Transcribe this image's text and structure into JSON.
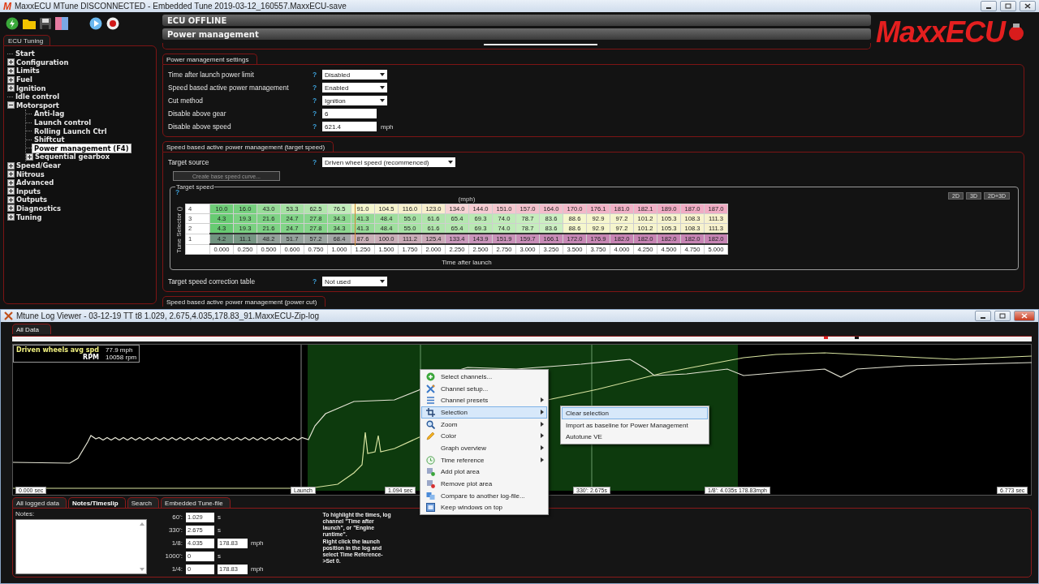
{
  "window": {
    "icon_letter": "M",
    "title": "MaxxECU MTune DISCONNECTED - Embedded Tune 2019-03-12_160557.MaxxECU-save"
  },
  "sidebar": {
    "tab": "ECU Tuning",
    "items": [
      {
        "label": "Start",
        "selected": false
      },
      {
        "label": "Configuration",
        "selected": false,
        "expanded": false
      },
      {
        "label": "Limits",
        "selected": false,
        "expanded": false
      },
      {
        "label": "Fuel",
        "selected": false,
        "expanded": false
      },
      {
        "label": "Ignition",
        "selected": false,
        "expanded": false
      },
      {
        "label": "Idle control",
        "selected": false
      },
      {
        "label": "Motorsport",
        "selected": false,
        "expanded": true,
        "children": [
          {
            "label": "Anti-lag",
            "selected": false
          },
          {
            "label": "Launch control",
            "selected": false
          },
          {
            "label": "Rolling Launch Ctrl",
            "selected": false
          },
          {
            "label": "Shiftcut",
            "selected": false
          },
          {
            "label": "Power management (F4)",
            "selected": true
          },
          {
            "label": "Sequential gearbox",
            "selected": false,
            "expanded": false
          }
        ]
      },
      {
        "label": "Speed/Gear",
        "selected": false,
        "expanded": false
      },
      {
        "label": "Nitrous",
        "selected": false,
        "expanded": false
      },
      {
        "label": "Advanced",
        "selected": false,
        "expanded": false
      },
      {
        "label": "Inputs",
        "selected": false,
        "expanded": false
      },
      {
        "label": "Outputs",
        "selected": false,
        "expanded": false
      },
      {
        "label": "Diagnostics",
        "selected": false,
        "expanded": false
      },
      {
        "label": "Tuning",
        "selected": false,
        "expanded": false
      }
    ]
  },
  "header": {
    "status": "ECU OFFLINE",
    "page": "Power management",
    "logo": "MaxxECU"
  },
  "settings": {
    "title": "Power management settings",
    "rows": [
      {
        "label": "Time after launch power limit",
        "help": "?",
        "kind": "dropdown",
        "value": "Disabled"
      },
      {
        "label": "Speed based active power management",
        "help": "?",
        "kind": "dropdown",
        "value": "Enabled"
      },
      {
        "label": "Cut method",
        "help": "?",
        "kind": "dropdown",
        "value": "Ignition"
      },
      {
        "label": "Disable above gear",
        "help": "?",
        "kind": "input",
        "value": "6"
      },
      {
        "label": "Disable above speed",
        "help": "?",
        "kind": "input",
        "value": "621.4",
        "unit": "mph"
      }
    ]
  },
  "target_speed_section": {
    "title": "Speed based active power management (target speed)",
    "target_source": {
      "label": "Target source",
      "help": "?",
      "value": "Driven wheel speed (recommenced)"
    },
    "create_button": "Create base speed curve...",
    "table": {
      "title": "Target speed",
      "help": "?",
      "unit": "(mph)",
      "y_label": "Tune Selector ()",
      "x_label": "Time after launch",
      "view_buttons": [
        "2D",
        "3D",
        "2D+3D"
      ],
      "rows": [
        {
          "label": "4",
          "selected": false,
          "values": [
            "10.0",
            "16.0",
            "43.0",
            "53.3",
            "62.5",
            "76.5",
            "91.0",
            "104.5",
            "116.0",
            "123.0",
            "134.0",
            "144.0",
            "151.0",
            "157.0",
            "164.0",
            "170.0",
            "176.1",
            "181.0",
            "182.1",
            "189.0",
            "187.0",
            "187.0"
          ]
        },
        {
          "label": "3",
          "selected": false,
          "values": [
            "4.3",
            "19.3",
            "21.6",
            "24.7",
            "27.8",
            "34.3",
            "41.3",
            "48.4",
            "55.0",
            "61.6",
            "65.4",
            "69.3",
            "74.0",
            "78.7",
            "83.6",
            "88.6",
            "92.9",
            "97.2",
            "101.2",
            "105.3",
            "108.3",
            "111.3"
          ]
        },
        {
          "label": "2",
          "selected": false,
          "values": [
            "4.3",
            "19.3",
            "21.6",
            "24.7",
            "27.8",
            "34.3",
            "41.3",
            "48.4",
            "55.0",
            "61.6",
            "65.4",
            "69.3",
            "74.0",
            "78.7",
            "83.6",
            "88.6",
            "92.9",
            "97.2",
            "101.2",
            "105.3",
            "108.3",
            "111.3"
          ]
        },
        {
          "label": "1",
          "selected": true,
          "values": [
            "4.2",
            "11.1",
            "48.2",
            "51.7",
            "57.2",
            "68.4",
            "87.6",
            "100.0",
            "111.2",
            "125.4",
            "133.4",
            "143.9",
            "151.9",
            "159.7",
            "166.1",
            "172.0",
            "176.9",
            "182.0",
            "182.0",
            "182.0",
            "182.0",
            "182.0"
          ]
        }
      ],
      "x_values": [
        "0.000",
        "0.250",
        "0.500",
        "0.600",
        "0.750",
        "1.000",
        "1.250",
        "1.500",
        "1.750",
        "2.000",
        "2.250",
        "2.500",
        "2.750",
        "3.000",
        "3.250",
        "3.500",
        "3.750",
        "4.000",
        "4.250",
        "4.500",
        "4.750",
        "5.000"
      ]
    },
    "correction": {
      "label": "Target speed correction table",
      "help": "?",
      "value": "Not used"
    }
  },
  "power_cut_section": {
    "title": "Speed based active power management (power cut)"
  },
  "log_viewer": {
    "title": "Mtune Log Viewer - 03-12-19 TT t8 1.029, 2.675,4.035,178.83_91.MaxxECU-Zip-log",
    "tab": "All Data",
    "legend": [
      {
        "name": "Driven wheels avg spd",
        "value": "77.9 mph",
        "color": "#f0f080"
      },
      {
        "name": "RPM",
        "value": "10058 rpm",
        "color": "#ffffff"
      }
    ],
    "markers": [
      "0.000 sec",
      "Launch",
      "1.094 sec",
      "330': 2.675s",
      "1/8': 4.035s 178.83mph",
      "6.773 sec"
    ],
    "context_menu": [
      {
        "label": "Select channels...",
        "submenu": false,
        "selected": false
      },
      {
        "label": "Channel setup...",
        "submenu": false,
        "selected": false
      },
      {
        "label": "Channel presets",
        "submenu": true,
        "selected": false
      },
      {
        "label": "Selection",
        "submenu": true,
        "selected": true
      },
      {
        "label": "Zoom",
        "submenu": true,
        "selected": false
      },
      {
        "label": "Color",
        "submenu": true,
        "selected": false
      },
      {
        "label": "Graph overview",
        "submenu": true,
        "selected": false
      },
      {
        "label": "Time reference",
        "submenu": true,
        "selected": false
      },
      {
        "label": "Add plot area",
        "submenu": false,
        "selected": false
      },
      {
        "label": "Remove plot area",
        "submenu": false,
        "selected": false
      },
      {
        "label": "Compare to another log-file...",
        "submenu": false,
        "selected": false
      },
      {
        "label": "Keep windows on top",
        "submenu": false,
        "selected": false
      }
    ],
    "submenu": [
      {
        "label": "Clear selection",
        "selected": true
      },
      {
        "label": "Import as baseline for Power Management",
        "selected": false
      },
      {
        "label": "Autotune VE",
        "selected": false
      }
    ],
    "bottom_tabs": [
      {
        "label": "All logged data",
        "selected": false
      },
      {
        "label": "Notes/Timeslip",
        "selected": true
      },
      {
        "label": "Search",
        "selected": false
      },
      {
        "label": "Embedded Tune-file",
        "selected": false
      }
    ],
    "notes_label": "Notes:",
    "timeslip": [
      {
        "label": "60':",
        "time": "1.029",
        "unit": "s"
      },
      {
        "label": "330':",
        "time": "2.675",
        "unit": "s"
      },
      {
        "label": "1/8:",
        "time": "4.035",
        "speed": "178.83",
        "unit": "mph"
      },
      {
        "label": "1000':",
        "time": "0",
        "unit": "s"
      },
      {
        "label": "1/4:",
        "time": "0",
        "speed": "178.83",
        "unit": "mph"
      }
    ],
    "help_text": [
      "To highlight the times, log channel \"Time after launch\", or \"Engine runtime\".",
      "Right click the launch position in the log and select Time Reference->Set 0."
    ]
  }
}
